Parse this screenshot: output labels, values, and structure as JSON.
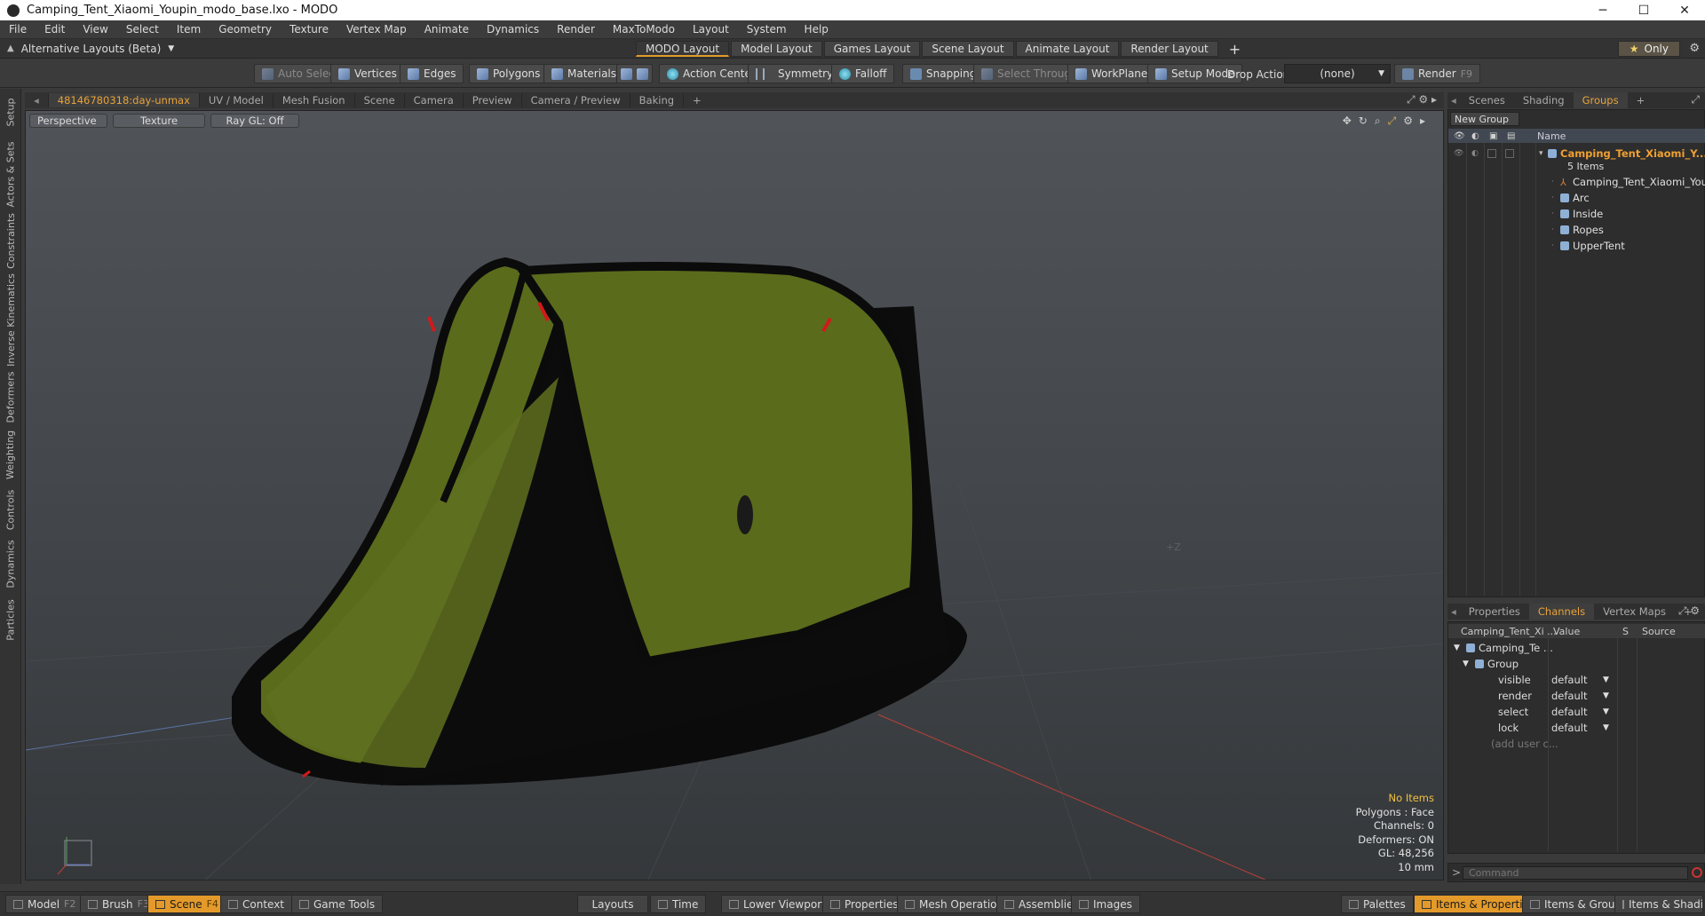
{
  "window": {
    "title": "Camping_Tent_Xiaomi_Youpin_modo_base.lxo - MODO",
    "minimize": "─",
    "maximize": "☐",
    "close": "✕"
  },
  "menu": [
    "File",
    "Edit",
    "View",
    "Select",
    "Item",
    "Geometry",
    "Texture",
    "Vertex Map",
    "Animate",
    "Dynamics",
    "Render",
    "MaxToModo",
    "Layout",
    "System",
    "Help"
  ],
  "layoutbar": {
    "alt_layouts": "Alternative Layouts (Beta)",
    "tabs": [
      "MODO Layout",
      "Model Layout",
      "Games Layout",
      "Scene Layout",
      "Animate Layout",
      "Render Layout"
    ],
    "add": "+",
    "only": "Only"
  },
  "toolbar": {
    "auto_select": "Auto Select",
    "vertices": "Vertices",
    "edges": "Edges",
    "polygons": "Polygons",
    "materials": "Materials",
    "action_center": "Action Center",
    "symmetry": "Symmetry",
    "falloff": "Falloff",
    "snapping": "Snapping",
    "select_through": "Select Through",
    "workplane": "WorkPlane",
    "setup_mode": "Setup Mode",
    "drop_action": "Drop Action",
    "drop_value": "(none)",
    "render": "Render",
    "render_key": "F9"
  },
  "left_tabs": [
    "Setup",
    "Actors & Sets",
    "Constraints",
    "Inverse Kinematics",
    "Deformers",
    "Weighting",
    "Controls",
    "Dynamics",
    "Particles"
  ],
  "viewport_tabs": [
    "48146780318:day-unmax",
    "UV / Model",
    "Mesh Fusion",
    "Scene",
    "Camera",
    "Preview",
    "Camera / Preview",
    "Baking",
    "+"
  ],
  "viewport": {
    "view_mode": "Perspective",
    "shading": "Texture",
    "raygl": "Ray GL: Off",
    "axis_label": "+Z",
    "info": {
      "items": "No Items",
      "polygons": "Polygons : Face",
      "channels": "Channels: 0",
      "deformers": "Deformers: ON",
      "gl": "GL: 48,256",
      "scale": "10 mm"
    }
  },
  "right_top_tabs": [
    "Scenes",
    "Shading",
    "Groups",
    "+"
  ],
  "groups": {
    "new_group": "New Group",
    "col_name": "Name",
    "root": {
      "name": "Camping_Tent_Xiaomi_Y...",
      "count": "5 Items"
    },
    "children": [
      "Camping_Tent_Xiaomi_Youpin",
      "Arc",
      "Inside",
      "Ropes",
      "UpperTent"
    ]
  },
  "right_bottom_tabs": [
    "Properties",
    "Channels",
    "Vertex Maps",
    "+"
  ],
  "channels": {
    "col_item": "Camping_Tent_Xi ...",
    "col_value": "Value",
    "col_s": "S",
    "col_source": "Source",
    "root": "Camping_Te ...",
    "group": "Group",
    "rows": [
      {
        "name": "visible",
        "value": "default"
      },
      {
        "name": "render",
        "value": "default"
      },
      {
        "name": "select",
        "value": "default"
      },
      {
        "name": "lock",
        "value": "default"
      }
    ],
    "add_user": "(add user c..."
  },
  "command": {
    "placeholder": "Command",
    "prompt": ">"
  },
  "bottom": {
    "model": "Model",
    "model_key": "F2",
    "brush": "Brush",
    "brush_key": "F3",
    "scene": "Scene",
    "scene_key": "F4",
    "context": "Context",
    "game_tools": "Game Tools",
    "layouts": "Layouts",
    "time": "Time",
    "lower_viewports": "Lower Viewports",
    "properties": "Properties",
    "mesh_operations": "Mesh Operations",
    "assemblies": "Assemblies",
    "images": "Images",
    "palettes": "Palettes",
    "items_properties": "Items & Properties",
    "items_groups": "Items & Groups",
    "items_shading": "Items & Shading"
  },
  "colors": {
    "accent": "#e39a2a",
    "tent_green": "#5a6b1c",
    "tent_black": "#0b0b0b",
    "rope_red": "#d11a1a"
  }
}
